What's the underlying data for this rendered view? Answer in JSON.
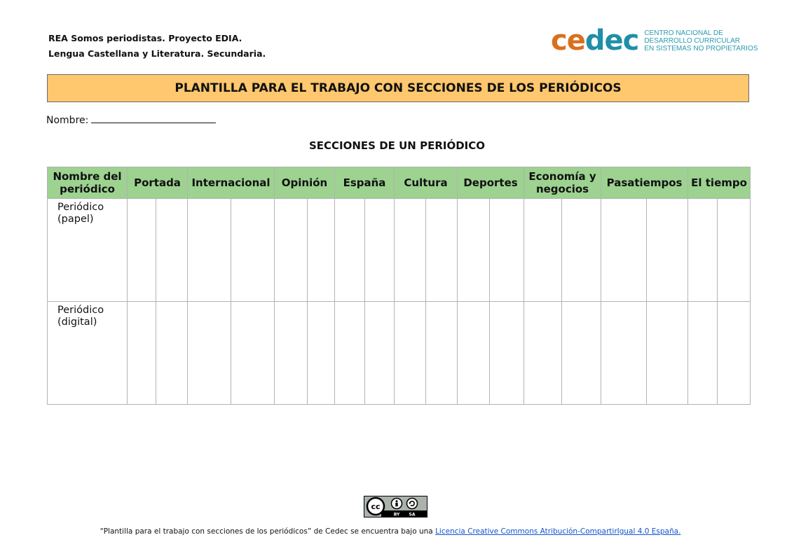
{
  "header": {
    "line1": "REA Somos periodistas. Proyecto EDIA.",
    "line2": "Lengua Castellana y Literatura. Secundaria."
  },
  "logo": {
    "brand_ce": "ce",
    "brand_dec": "dec",
    "sub1": "CENTRO NACIONAL DE",
    "sub2": "DESARROLLO CURRICULAR",
    "sub3": "EN SISTEMAS NO PROPIETARIOS",
    "color_ce": "#d9701e",
    "color_dec": "#1f8fa8"
  },
  "title": "PLANTILLA PARA EL TRABAJO CON SECCIONES DE LOS PERIÓDICOS",
  "nombre_label": "Nombre:",
  "section_title": "SECCIONES DE UN PERIÓDICO",
  "table": {
    "col0": "Nombre del periódico",
    "columns": [
      "Portada",
      "Internacional",
      "Opinión",
      "España",
      "Cultura",
      "Deportes",
      "Economía y negocios",
      "Pasatiempos",
      "El tiempo"
    ],
    "rows": [
      "Periódico (papel)",
      "Periódico (digital)"
    ]
  },
  "license": {
    "badge_icon": "creative-commons-by-sa-icon",
    "badge_by": "BY",
    "badge_sa": "SA",
    "text_prefix": "“Plantilla para el trabajo con secciones de los periódicos” de Cedec se encuentra bajo una ",
    "link_text": "Licencia Creative Commons Atribución-CompartirIgual 4.0 España."
  }
}
